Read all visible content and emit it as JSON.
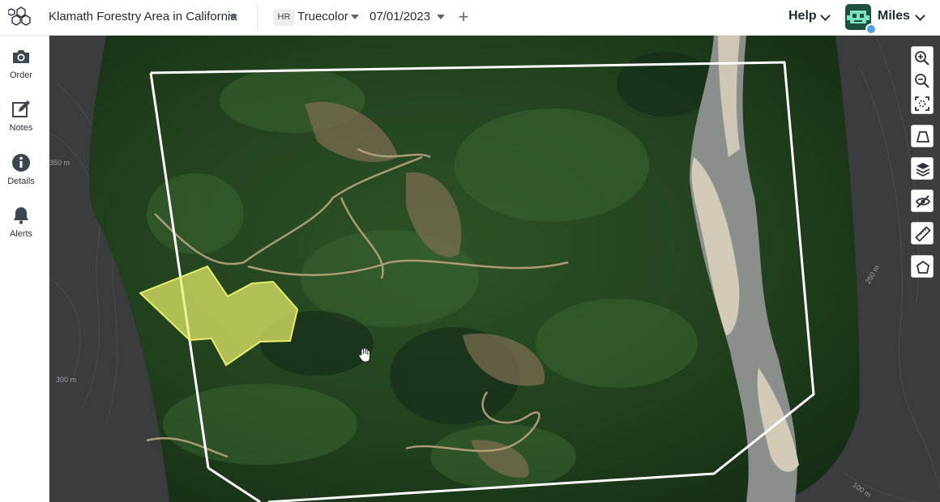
{
  "header": {
    "aoi_name": "Klamath Forestry Area in California",
    "imagery_badge": "HR",
    "layer_name": "Truecolor",
    "date": "07/01/2023",
    "add_label": "+",
    "help_label": "Help",
    "user_name": "Miles"
  },
  "sidebar": {
    "items": [
      {
        "label": "Order",
        "icon": "camera-icon"
      },
      {
        "label": "Notes",
        "icon": "edit-icon"
      },
      {
        "label": "Details",
        "icon": "info-icon"
      },
      {
        "label": "Alerts",
        "icon": "bell-icon"
      }
    ]
  },
  "map": {
    "contour_labels": [
      "350 m",
      "300 m",
      "250 m",
      "100 m"
    ],
    "aoi_outline_color": "#ffffff",
    "selection_fill_color": "#e7ee6a",
    "tools": [
      "zoom-in-icon",
      "zoom-out-icon",
      "fit-bounds-icon",
      "aoi-shape-icon",
      "layers-icon",
      "hide-icon",
      "ruler-icon",
      "polygon-draw-icon"
    ]
  },
  "colors": {
    "accent": "#1f2a33",
    "avatar_bg": "#1e4f43",
    "status_dot": "#4aa3e0"
  }
}
